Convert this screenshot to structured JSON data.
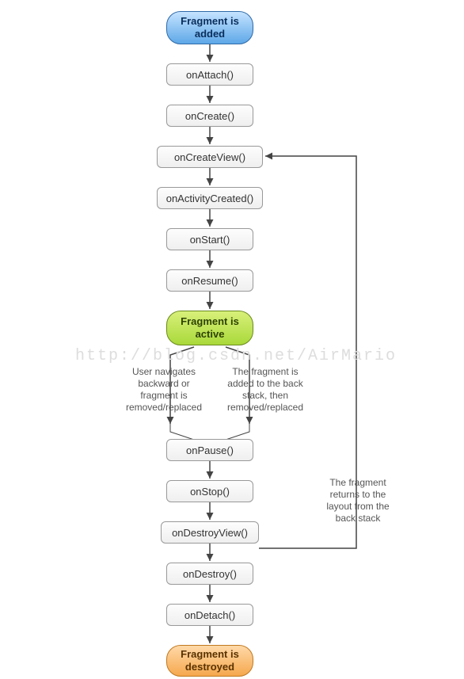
{
  "nodes": {
    "added": "Fragment is\nadded",
    "onAttach": "onAttach()",
    "onCreate": "onCreate()",
    "onCreateView": "onCreateView()",
    "onActivityCreated": "onActivityCreated()",
    "onStart": "onStart()",
    "onResume": "onResume()",
    "active": "Fragment is\nactive",
    "onPause": "onPause()",
    "onStop": "onStop()",
    "onDestroyView": "onDestroyView()",
    "onDestroy": "onDestroy()",
    "onDetach": "onDetach()",
    "destroyed": "Fragment is\ndestroyed"
  },
  "labels": {
    "left_branch": "User navigates\nbackward or\nfragment is\nremoved/replaced",
    "right_branch": "The fragment is\nadded to the back\nstack, then\nremoved/replaced",
    "return_branch": "The fragment\nreturns to the\nlayout from the\nback stack"
  },
  "watermark": "http://blog.csdn.net/AirMario",
  "chart_data": {
    "type": "flowchart",
    "title": "Fragment lifecycle",
    "nodes": [
      {
        "id": "added",
        "label": "Fragment is added",
        "type": "start"
      },
      {
        "id": "onAttach",
        "label": "onAttach()",
        "type": "process"
      },
      {
        "id": "onCreate",
        "label": "onCreate()",
        "type": "process"
      },
      {
        "id": "onCreateView",
        "label": "onCreateView()",
        "type": "process"
      },
      {
        "id": "onActivityCreated",
        "label": "onActivityCreated()",
        "type": "process"
      },
      {
        "id": "onStart",
        "label": "onStart()",
        "type": "process"
      },
      {
        "id": "onResume",
        "label": "onResume()",
        "type": "process"
      },
      {
        "id": "active",
        "label": "Fragment is active",
        "type": "state"
      },
      {
        "id": "onPause",
        "label": "onPause()",
        "type": "process"
      },
      {
        "id": "onStop",
        "label": "onStop()",
        "type": "process"
      },
      {
        "id": "onDestroyView",
        "label": "onDestroyView()",
        "type": "process"
      },
      {
        "id": "onDestroy",
        "label": "onDestroy()",
        "type": "process"
      },
      {
        "id": "onDetach",
        "label": "onDetach()",
        "type": "process"
      },
      {
        "id": "destroyed",
        "label": "Fragment is destroyed",
        "type": "end"
      }
    ],
    "edges": [
      {
        "from": "added",
        "to": "onAttach"
      },
      {
        "from": "onAttach",
        "to": "onCreate"
      },
      {
        "from": "onCreate",
        "to": "onCreateView"
      },
      {
        "from": "onCreateView",
        "to": "onActivityCreated"
      },
      {
        "from": "onActivityCreated",
        "to": "onStart"
      },
      {
        "from": "onStart",
        "to": "onResume"
      },
      {
        "from": "onResume",
        "to": "active"
      },
      {
        "from": "active",
        "to": "onPause",
        "label": "User navigates backward or fragment is removed/replaced"
      },
      {
        "from": "active",
        "to": "onPause",
        "label": "The fragment is added to the back stack, then removed/replaced"
      },
      {
        "from": "onPause",
        "to": "onStop"
      },
      {
        "from": "onStop",
        "to": "onDestroyView"
      },
      {
        "from": "onDestroyView",
        "to": "onCreateView",
        "label": "The fragment returns to the layout from the back stack"
      },
      {
        "from": "onDestroyView",
        "to": "onDestroy"
      },
      {
        "from": "onDestroy",
        "to": "onDetach"
      },
      {
        "from": "onDetach",
        "to": "destroyed"
      }
    ]
  }
}
